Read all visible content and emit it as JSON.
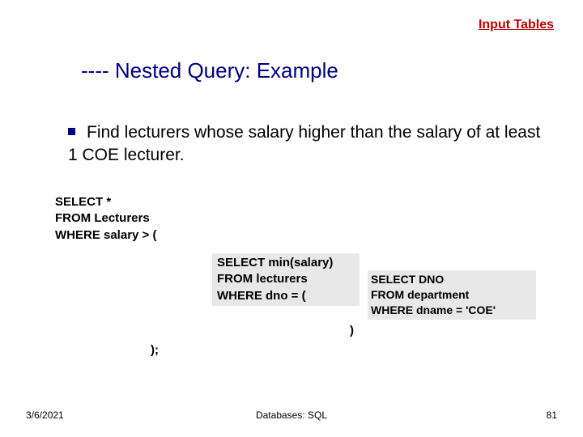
{
  "top_link": "Input Tables",
  "title_prefix": "---- ",
  "title_text": "Nested Query: Example",
  "bullet_text": "Find lecturers whose salary higher than the salary of at least 1 COE lecturer.",
  "outer_query": {
    "l1": "SELECT *",
    "l2": "FROM Lecturers",
    "l3": "WHERE salary  >   ("
  },
  "mid_query": {
    "l1": "SELECT min(salary)",
    "l2": "FROM lecturers",
    "l3": "WHERE dno  =      ("
  },
  "inner_query": {
    "l1": "SELECT DNO",
    "l2": "FROM department",
    "l3": "WHERE dname  =  'COE'"
  },
  "close_mid": ")",
  "close_outer": ");",
  "footer": {
    "date": "3/6/2021",
    "center": "Databases: SQL",
    "page": "81"
  }
}
